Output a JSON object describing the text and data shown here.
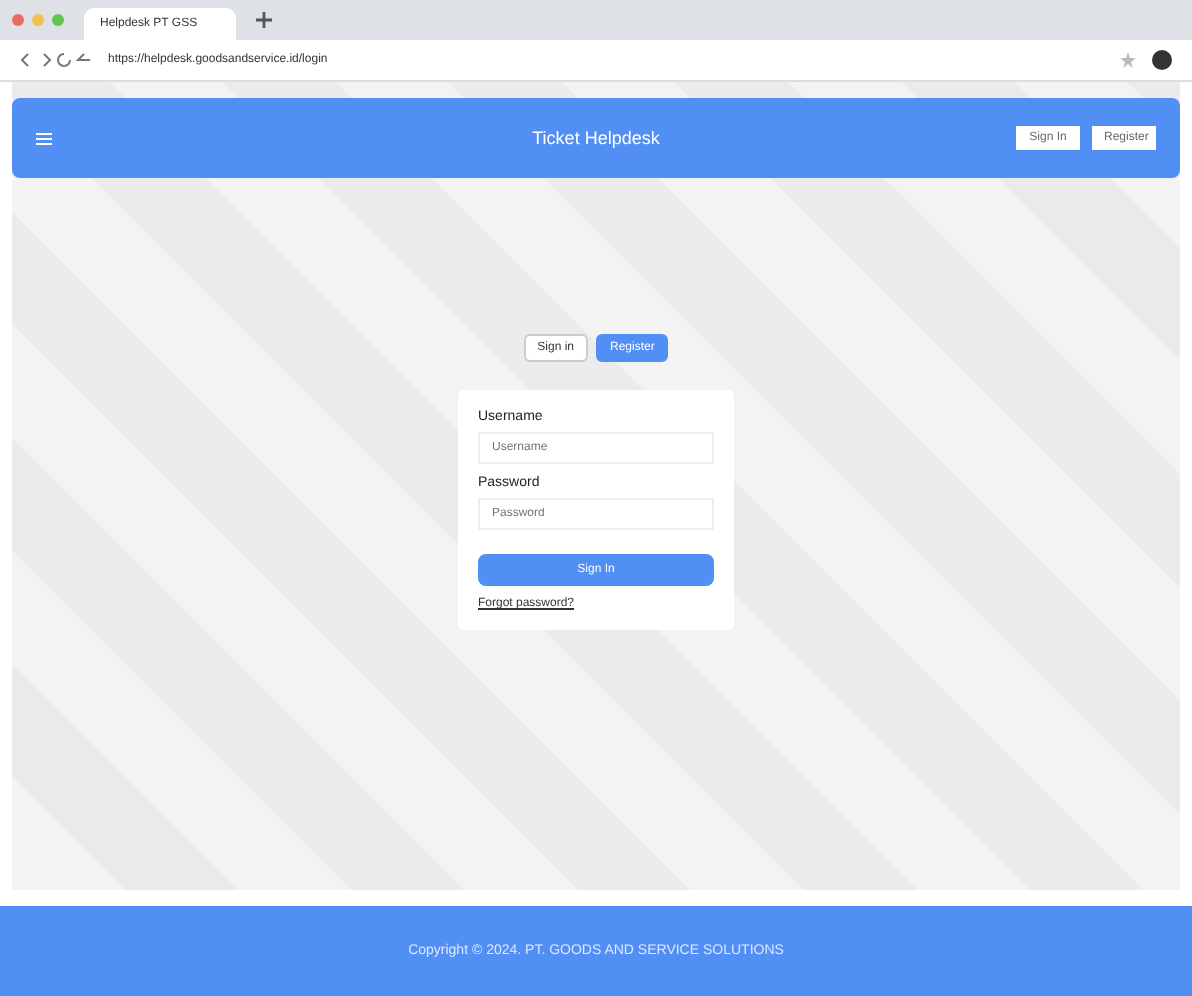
{
  "browser": {
    "tab_title": "Helpdesk PT GSS",
    "address": "https://helpdesk.goodsandservice.id/login"
  },
  "header": {
    "title": "Ticket Helpdesk",
    "buttons": [
      "Sign In",
      "Register"
    ]
  },
  "auth_tabs": [
    {
      "label": "Sign in",
      "selected": false
    },
    {
      "label": "Register",
      "selected": true
    }
  ],
  "form": {
    "fields": [
      {
        "label": "Username",
        "placeholder": "Username"
      },
      {
        "label": "Password",
        "placeholder": "Password"
      }
    ],
    "submit": "Sign In",
    "link": "Forgot password?"
  },
  "footer": {
    "text": "Copyright © 2024. PT. GOODS AND SERVICE SOLUTIONS"
  }
}
